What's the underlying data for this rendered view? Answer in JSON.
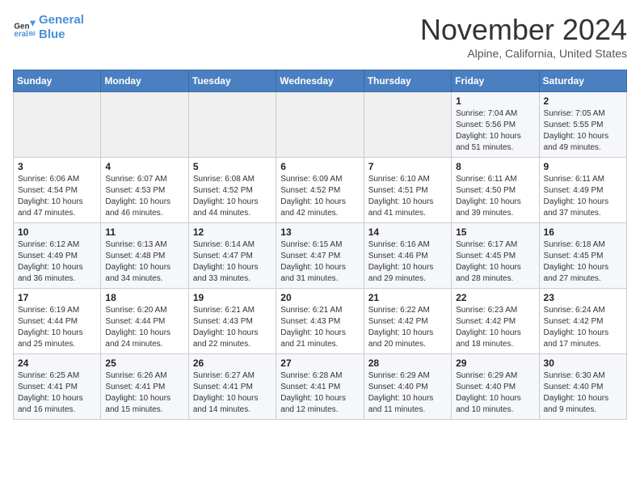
{
  "header": {
    "logo_line1": "General",
    "logo_line2": "Blue",
    "month": "November 2024",
    "location": "Alpine, California, United States"
  },
  "weekdays": [
    "Sunday",
    "Monday",
    "Tuesday",
    "Wednesday",
    "Thursday",
    "Friday",
    "Saturday"
  ],
  "weeks": [
    [
      {
        "day": "",
        "info": ""
      },
      {
        "day": "",
        "info": ""
      },
      {
        "day": "",
        "info": ""
      },
      {
        "day": "",
        "info": ""
      },
      {
        "day": "",
        "info": ""
      },
      {
        "day": "1",
        "info": "Sunrise: 7:04 AM\nSunset: 5:56 PM\nDaylight: 10 hours\nand 51 minutes."
      },
      {
        "day": "2",
        "info": "Sunrise: 7:05 AM\nSunset: 5:55 PM\nDaylight: 10 hours\nand 49 minutes."
      }
    ],
    [
      {
        "day": "3",
        "info": "Sunrise: 6:06 AM\nSunset: 4:54 PM\nDaylight: 10 hours\nand 47 minutes."
      },
      {
        "day": "4",
        "info": "Sunrise: 6:07 AM\nSunset: 4:53 PM\nDaylight: 10 hours\nand 46 minutes."
      },
      {
        "day": "5",
        "info": "Sunrise: 6:08 AM\nSunset: 4:52 PM\nDaylight: 10 hours\nand 44 minutes."
      },
      {
        "day": "6",
        "info": "Sunrise: 6:09 AM\nSunset: 4:52 PM\nDaylight: 10 hours\nand 42 minutes."
      },
      {
        "day": "7",
        "info": "Sunrise: 6:10 AM\nSunset: 4:51 PM\nDaylight: 10 hours\nand 41 minutes."
      },
      {
        "day": "8",
        "info": "Sunrise: 6:11 AM\nSunset: 4:50 PM\nDaylight: 10 hours\nand 39 minutes."
      },
      {
        "day": "9",
        "info": "Sunrise: 6:11 AM\nSunset: 4:49 PM\nDaylight: 10 hours\nand 37 minutes."
      }
    ],
    [
      {
        "day": "10",
        "info": "Sunrise: 6:12 AM\nSunset: 4:49 PM\nDaylight: 10 hours\nand 36 minutes."
      },
      {
        "day": "11",
        "info": "Sunrise: 6:13 AM\nSunset: 4:48 PM\nDaylight: 10 hours\nand 34 minutes."
      },
      {
        "day": "12",
        "info": "Sunrise: 6:14 AM\nSunset: 4:47 PM\nDaylight: 10 hours\nand 33 minutes."
      },
      {
        "day": "13",
        "info": "Sunrise: 6:15 AM\nSunset: 4:47 PM\nDaylight: 10 hours\nand 31 minutes."
      },
      {
        "day": "14",
        "info": "Sunrise: 6:16 AM\nSunset: 4:46 PM\nDaylight: 10 hours\nand 29 minutes."
      },
      {
        "day": "15",
        "info": "Sunrise: 6:17 AM\nSunset: 4:45 PM\nDaylight: 10 hours\nand 28 minutes."
      },
      {
        "day": "16",
        "info": "Sunrise: 6:18 AM\nSunset: 4:45 PM\nDaylight: 10 hours\nand 27 minutes."
      }
    ],
    [
      {
        "day": "17",
        "info": "Sunrise: 6:19 AM\nSunset: 4:44 PM\nDaylight: 10 hours\nand 25 minutes."
      },
      {
        "day": "18",
        "info": "Sunrise: 6:20 AM\nSunset: 4:44 PM\nDaylight: 10 hours\nand 24 minutes."
      },
      {
        "day": "19",
        "info": "Sunrise: 6:21 AM\nSunset: 4:43 PM\nDaylight: 10 hours\nand 22 minutes."
      },
      {
        "day": "20",
        "info": "Sunrise: 6:21 AM\nSunset: 4:43 PM\nDaylight: 10 hours\nand 21 minutes."
      },
      {
        "day": "21",
        "info": "Sunrise: 6:22 AM\nSunset: 4:42 PM\nDaylight: 10 hours\nand 20 minutes."
      },
      {
        "day": "22",
        "info": "Sunrise: 6:23 AM\nSunset: 4:42 PM\nDaylight: 10 hours\nand 18 minutes."
      },
      {
        "day": "23",
        "info": "Sunrise: 6:24 AM\nSunset: 4:42 PM\nDaylight: 10 hours\nand 17 minutes."
      }
    ],
    [
      {
        "day": "24",
        "info": "Sunrise: 6:25 AM\nSunset: 4:41 PM\nDaylight: 10 hours\nand 16 minutes."
      },
      {
        "day": "25",
        "info": "Sunrise: 6:26 AM\nSunset: 4:41 PM\nDaylight: 10 hours\nand 15 minutes."
      },
      {
        "day": "26",
        "info": "Sunrise: 6:27 AM\nSunset: 4:41 PM\nDaylight: 10 hours\nand 14 minutes."
      },
      {
        "day": "27",
        "info": "Sunrise: 6:28 AM\nSunset: 4:41 PM\nDaylight: 10 hours\nand 12 minutes."
      },
      {
        "day": "28",
        "info": "Sunrise: 6:29 AM\nSunset: 4:40 PM\nDaylight: 10 hours\nand 11 minutes."
      },
      {
        "day": "29",
        "info": "Sunrise: 6:29 AM\nSunset: 4:40 PM\nDaylight: 10 hours\nand 10 minutes."
      },
      {
        "day": "30",
        "info": "Sunrise: 6:30 AM\nSunset: 4:40 PM\nDaylight: 10 hours\nand 9 minutes."
      }
    ]
  ]
}
